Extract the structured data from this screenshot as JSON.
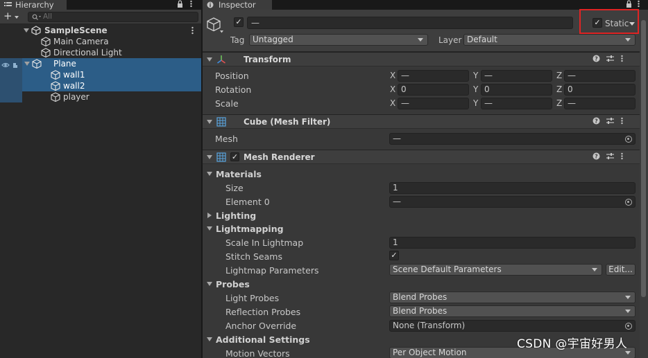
{
  "hierarchy": {
    "tab_label": "Hierarchy",
    "search_placeholder": "All",
    "add_label": "+",
    "rows": [
      {
        "label": "SampleScene"
      },
      {
        "label": "Main Camera"
      },
      {
        "label": "Directional Light"
      },
      {
        "label": "Plane"
      },
      {
        "label": "wall1"
      },
      {
        "label": "wall2"
      },
      {
        "label": "player"
      }
    ]
  },
  "inspector": {
    "tab_label": "Inspector",
    "object_name": "—",
    "static_label": "Static",
    "tag_label": "Tag",
    "tag_value": "Untagged",
    "layer_label": "Layer",
    "layer_value": "Default",
    "transform": {
      "title": "Transform",
      "rows": [
        {
          "label": "Position",
          "x": "—",
          "y": "—",
          "z": "—"
        },
        {
          "label": "Rotation",
          "x": "0",
          "y": "0",
          "z": "0"
        },
        {
          "label": "Scale",
          "x": "—",
          "y": "—",
          "z": "—"
        }
      ],
      "axes": [
        "X",
        "Y",
        "Z"
      ]
    },
    "mesh_filter": {
      "title": "Cube (Mesh Filter)",
      "mesh_label": "Mesh",
      "mesh_value": "—"
    },
    "mesh_renderer": {
      "title": "Mesh Renderer",
      "materials_label": "Materials",
      "size_label": "Size",
      "size_value": "1",
      "element0_label": "Element 0",
      "element0_value": "—",
      "lighting_label": "Lighting",
      "lightmapping_label": "Lightmapping",
      "scale_lightmap_label": "Scale In Lightmap",
      "scale_lightmap_value": "1",
      "stitch_seams_label": "Stitch Seams",
      "lightmap_params_label": "Lightmap Parameters",
      "lightmap_params_value": "Scene Default Parameters",
      "edit_label": "Edit...",
      "probes_label": "Probes",
      "light_probes_label": "Light Probes",
      "light_probes_value": "Blend Probes",
      "reflection_probes_label": "Reflection Probes",
      "reflection_probes_value": "Blend Probes",
      "anchor_override_label": "Anchor Override",
      "anchor_override_value": "None (Transform)",
      "additional_label": "Additional Settings",
      "motion_vectors_label": "Motion Vectors",
      "motion_vectors_value": "Per Object Motion"
    }
  },
  "watermark": "CSDN @宇宙好男人",
  "colors": {
    "selection": "#2c5d87",
    "highlight": "#e02424",
    "panel": "#383838"
  }
}
